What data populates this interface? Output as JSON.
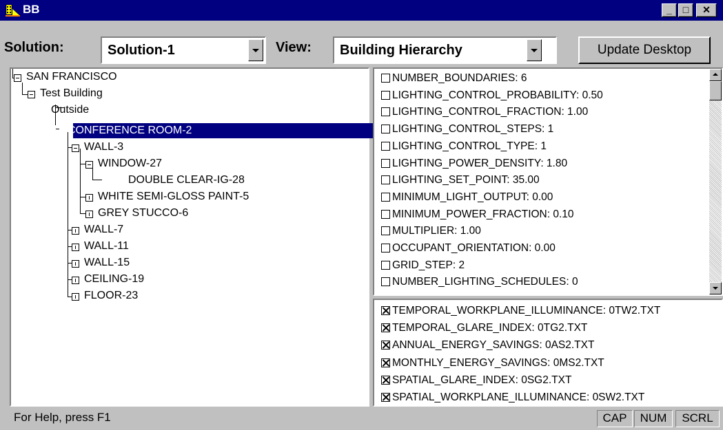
{
  "window": {
    "title": "BB",
    "minimize_glyph": "_",
    "maximize_glyph": "□",
    "close_glyph": "✕"
  },
  "toolbar": {
    "solution_label": "Solution:",
    "solution_value": "Solution-1",
    "view_label": "View:",
    "view_value": "Building Hierarchy",
    "update_button": "Update Desktop"
  },
  "tree": {
    "nodes": [
      {
        "label": "SAN FRANCISCO",
        "expander": "minus"
      },
      {
        "label": "Test Building",
        "expander": "minus"
      },
      {
        "label": "Outside",
        "expander": "none"
      },
      {
        "label": "CONFERENCE ROOM-2",
        "expander": "minus",
        "selected": true
      },
      {
        "label": "WALL-3",
        "expander": "minus"
      },
      {
        "label": "WINDOW-27",
        "expander": "minus"
      },
      {
        "label": "DOUBLE CLEAR-IG-28",
        "expander": "none"
      },
      {
        "label": "WHITE SEMI-GLOSS PAINT-5",
        "expander": "plus"
      },
      {
        "label": "GREY STUCCO-6",
        "expander": "plus"
      },
      {
        "label": "WALL-7",
        "expander": "plus"
      },
      {
        "label": "WALL-11",
        "expander": "plus"
      },
      {
        "label": "WALL-15",
        "expander": "plus"
      },
      {
        "label": "CEILING-19",
        "expander": "plus"
      },
      {
        "label": "FLOOR-23",
        "expander": "plus"
      }
    ]
  },
  "properties": [
    {
      "text": "NUMBER_BOUNDARIES:  6",
      "checked": false
    },
    {
      "text": "LIGHTING_CONTROL_PROBABILITY:  0.50",
      "checked": false
    },
    {
      "text": "LIGHTING_CONTROL_FRACTION:  1.00",
      "checked": false
    },
    {
      "text": "LIGHTING_CONTROL_STEPS:  1",
      "checked": false
    },
    {
      "text": "LIGHTING_CONTROL_TYPE:  1",
      "checked": false
    },
    {
      "text": "LIGHTING_POWER_DENSITY:  1.80",
      "checked": false
    },
    {
      "text": "LIGHTING_SET_POINT:  35.00",
      "checked": false
    },
    {
      "text": "MINIMUM_LIGHT_OUTPUT:  0.00",
      "checked": false
    },
    {
      "text": "MINIMUM_POWER_FRACTION:  0.10",
      "checked": false
    },
    {
      "text": "MULTIPLIER:  1.00",
      "checked": false
    },
    {
      "text": "OCCUPANT_ORIENTATION:  0.00",
      "checked": false
    },
    {
      "text": "GRID_STEP:  2",
      "checked": false
    },
    {
      "text": "NUMBER_LIGHTING_SCHEDULES:  0",
      "checked": false
    }
  ],
  "outputs": [
    {
      "text": "TEMPORAL_WORKPLANE_ILLUMINANCE:  0TW2.TXT",
      "checked": true
    },
    {
      "text": "TEMPORAL_GLARE_INDEX:  0TG2.TXT",
      "checked": true
    },
    {
      "text": "ANNUAL_ENERGY_SAVINGS:  0AS2.TXT",
      "checked": true
    },
    {
      "text": "MONTHLY_ENERGY_SAVINGS:  0MS2.TXT",
      "checked": true
    },
    {
      "text": "SPATIAL_GLARE_INDEX:  0SG2.TXT",
      "checked": true
    },
    {
      "text": "SPATIAL_WORKPLANE_ILLUMINANCE:  0SW2.TXT",
      "checked": true
    }
  ],
  "statusbar": {
    "help_text": "For Help, press F1",
    "indicators": [
      "CAP",
      "NUM",
      "SCRL"
    ]
  },
  "colors": {
    "titlebar": "#000080",
    "selection": "#000080",
    "face": "#c0c0c0"
  }
}
